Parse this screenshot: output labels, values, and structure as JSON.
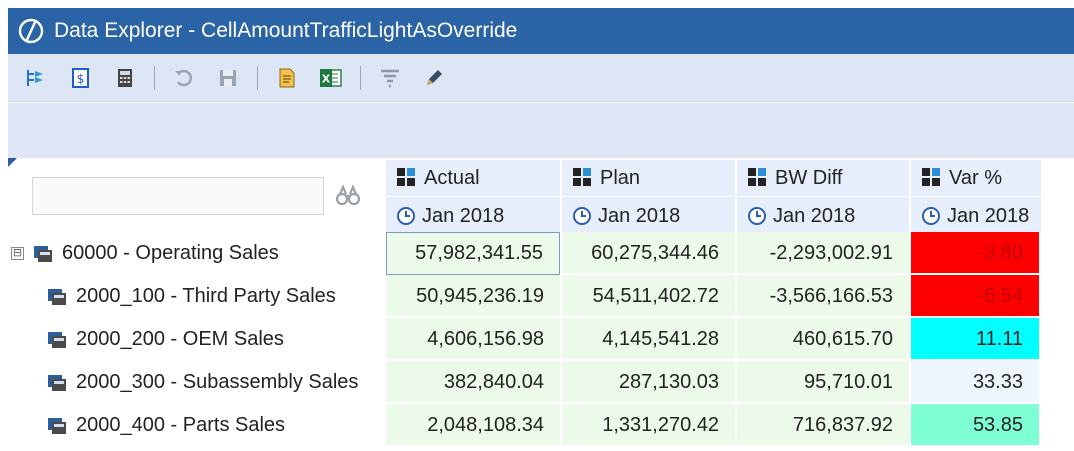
{
  "window": {
    "title": "Data Explorer - CellAmountTrafficLightAsOverride"
  },
  "toolbar": {
    "buttons": [
      {
        "icon": "expand-tree-icon"
      },
      {
        "icon": "calculate-sheet-icon"
      },
      {
        "icon": "calculator-icon"
      },
      {
        "icon": "undo-icon"
      },
      {
        "icon": "save-icon"
      },
      {
        "icon": "document-icon"
      },
      {
        "icon": "excel-icon"
      },
      {
        "icon": "filter-icon"
      },
      {
        "icon": "pencil-icon"
      }
    ]
  },
  "grid": {
    "columns": [
      {
        "label": "Actual",
        "period": "Jan 2018"
      },
      {
        "label": "Plan",
        "period": "Jan 2018"
      },
      {
        "label": "BW Diff",
        "period": "Jan 2018"
      },
      {
        "label": "Var %",
        "period": "Jan 2018"
      }
    ],
    "rows": [
      {
        "label": "60000 - Operating Sales",
        "expander": "⊟",
        "values": [
          "57,982,341.55",
          "60,275,344.46",
          "-2,293,002.91",
          "-3.80"
        ]
      },
      {
        "label": "2000_100 - Third Party Sales",
        "values": [
          "50,945,236.19",
          "54,511,402.72",
          "-3,566,166.53",
          "-6.54"
        ]
      },
      {
        "label": "2000_200 - OEM Sales",
        "values": [
          "4,606,156.98",
          "4,145,541.28",
          "460,615.70",
          "11.11"
        ]
      },
      {
        "label": "2000_300 - Subassembly Sales",
        "values": [
          "382,840.04",
          "287,130.03",
          "95,710.01",
          "33.33"
        ]
      },
      {
        "label": "2000_400 - Parts Sales",
        "values": [
          "2,048,108.34",
          "1,331,270.42",
          "716,837.92",
          "53.85"
        ]
      }
    ],
    "traffic_light": {
      "colors": [
        "#ff0000",
        "#ff0000",
        "#00ffff",
        "#f0f6ff",
        "#7fffd4"
      ],
      "text_colors": [
        "#c00000",
        "#c00000",
        "#222222",
        "#222222",
        "#222222"
      ]
    }
  }
}
